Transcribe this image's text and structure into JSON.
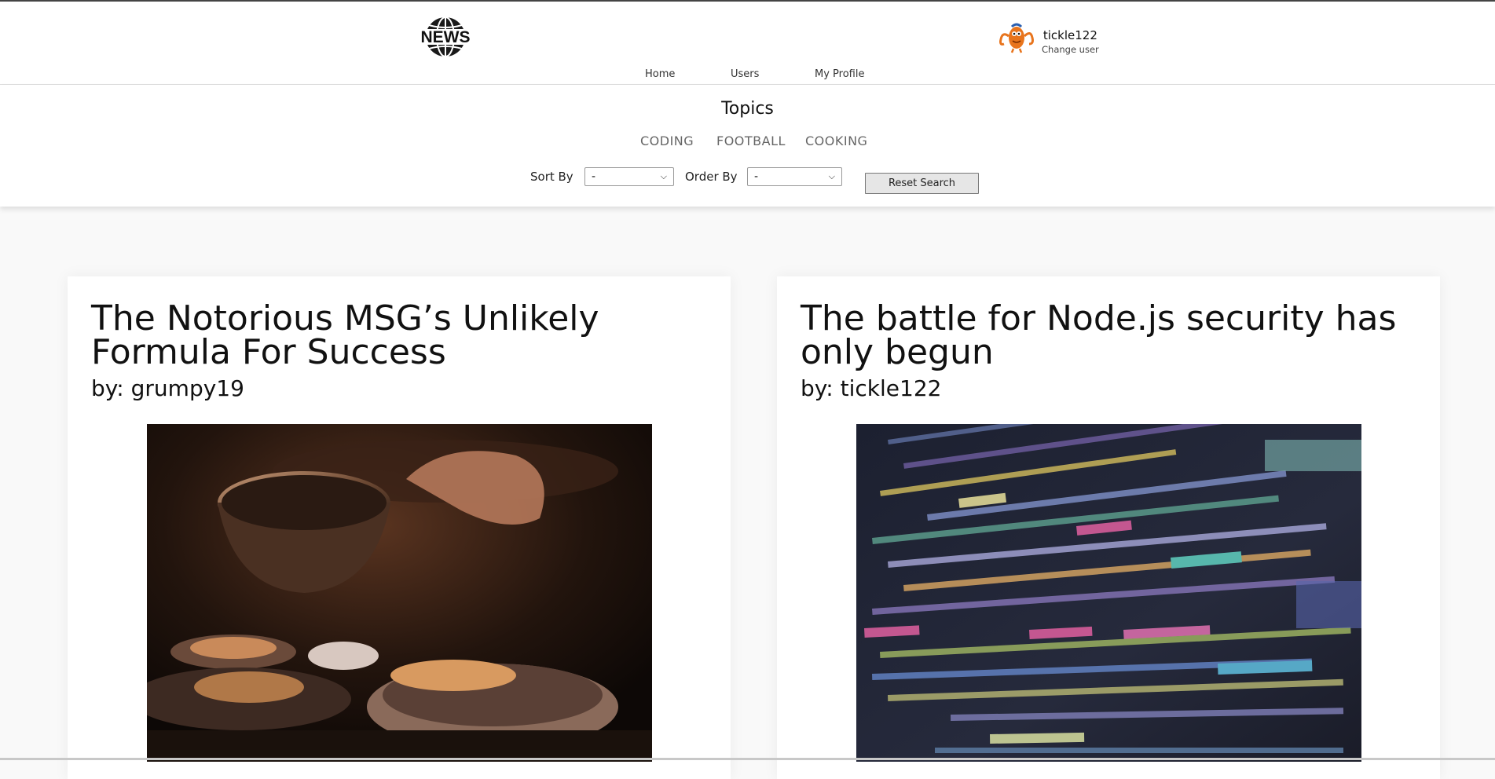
{
  "header": {
    "logo_text": "NEWS",
    "user": {
      "username": "tickle122",
      "change_user_label": "Change user"
    },
    "nav": [
      {
        "label": "Home"
      },
      {
        "label": "Users"
      },
      {
        "label": "My Profile"
      }
    ]
  },
  "filters": {
    "title": "Topics",
    "topics": [
      {
        "label": "CODING"
      },
      {
        "label": "FOOTBALL"
      },
      {
        "label": "COOKING"
      }
    ],
    "sort_by": {
      "label": "Sort By",
      "selected": "-"
    },
    "order_by": {
      "label": "Order By",
      "selected": "-"
    },
    "reset_label": "Reset Search"
  },
  "articles": [
    {
      "title": "The Notorious MSG’s Unlikely Formula For Success",
      "author": "by: grumpy19",
      "image_icon": "cooking-photo"
    },
    {
      "title": "The battle for Node.js security has only begun",
      "author": "by: tickle122",
      "image_icon": "code-screen-photo"
    }
  ]
}
